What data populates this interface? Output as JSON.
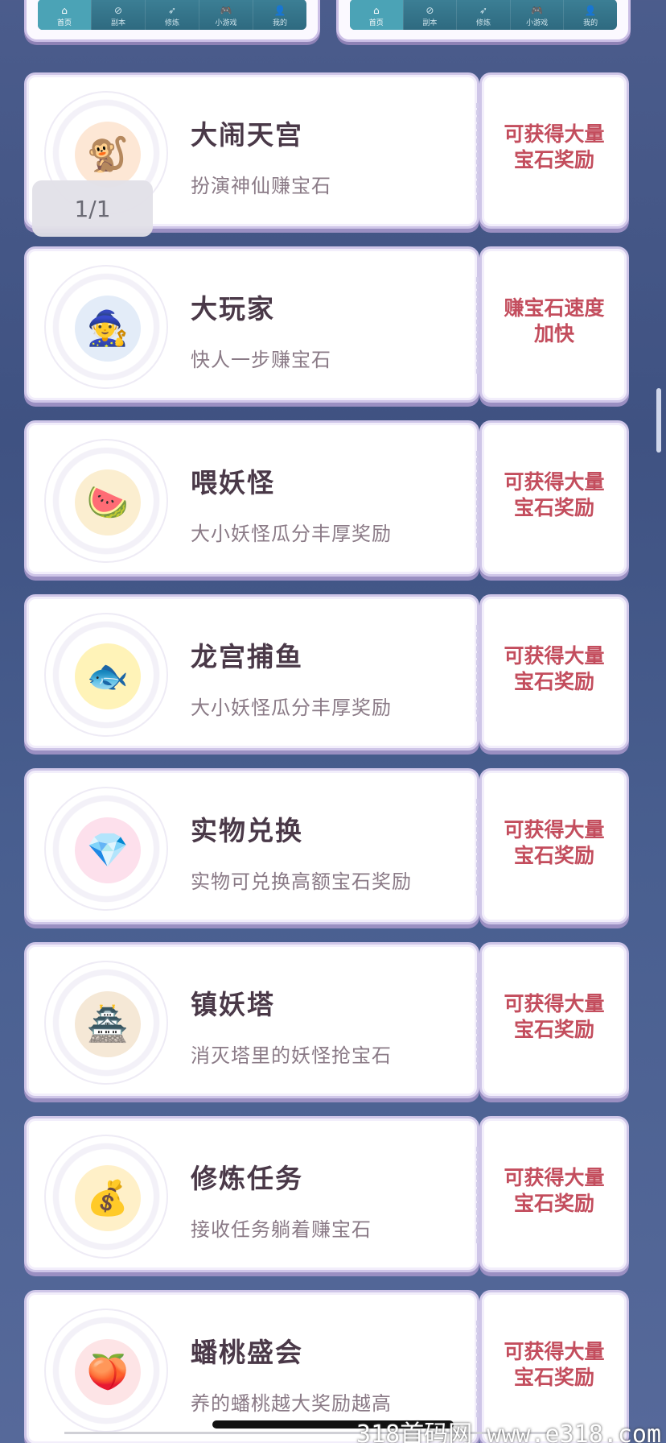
{
  "top_tabs": [
    "首页",
    "副本",
    "修炼",
    "小游戏",
    "我的"
  ],
  "tab_glyphs": [
    "⌂",
    "⊘",
    "➶",
    "🎮",
    "👤"
  ],
  "cards": [
    {
      "title": "大闹天宫",
      "subtitle": "扮演神仙赚宝石",
      "reward_line1": "可获得大量",
      "reward_line2": "宝石奖励",
      "icon": "monkey-king-icon",
      "glyph": "🐒"
    },
    {
      "title": "大玩家",
      "subtitle": "快人一步赚宝石",
      "reward_line1": "赚宝石速度",
      "reward_line2": "加快",
      "icon": "hero-character-icon",
      "glyph": "🧙"
    },
    {
      "title": "喂妖怪",
      "subtitle": "大小妖怪瓜分丰厚奖励",
      "reward_line1": "可获得大量",
      "reward_line2": "宝石奖励",
      "icon": "demon-eating-watermelon-icon",
      "glyph": "🍉"
    },
    {
      "title": "龙宫捕鱼",
      "subtitle": "大小妖怪瓜分丰厚奖励",
      "reward_line1": "可获得大量",
      "reward_line2": "宝石奖励",
      "icon": "golden-fish-icon",
      "glyph": "🐟"
    },
    {
      "title": "实物兑换",
      "subtitle": "实物可兑换高额宝石奖励",
      "reward_line1": "可获得大量",
      "reward_line2": "宝石奖励",
      "icon": "pink-gem-icon",
      "glyph": "💎"
    },
    {
      "title": "镇妖塔",
      "subtitle": "消灭塔里的妖怪抢宝石",
      "reward_line1": "可获得大量",
      "reward_line2": "宝石奖励",
      "icon": "pagoda-tower-icon",
      "glyph": "🏯"
    },
    {
      "title": "修炼任务",
      "subtitle": "接收任务躺着赚宝石",
      "reward_line1": "可获得大量",
      "reward_line2": "宝石奖励",
      "icon": "gold-ingot-character-icon",
      "glyph": "💰"
    },
    {
      "title": "蟠桃盛会",
      "subtitle": "养的蟠桃越大奖励越高",
      "reward_line1": "可获得大量",
      "reward_line2": "宝石奖励",
      "icon": "peach-bowl-icon",
      "glyph": "🍑"
    }
  ],
  "page_indicator": "1/1",
  "watermark": "318首码网 www.e318.com",
  "colors": {
    "accent": "#c34d5d",
    "title": "#4a3948",
    "subtitle": "#8a7a86"
  }
}
